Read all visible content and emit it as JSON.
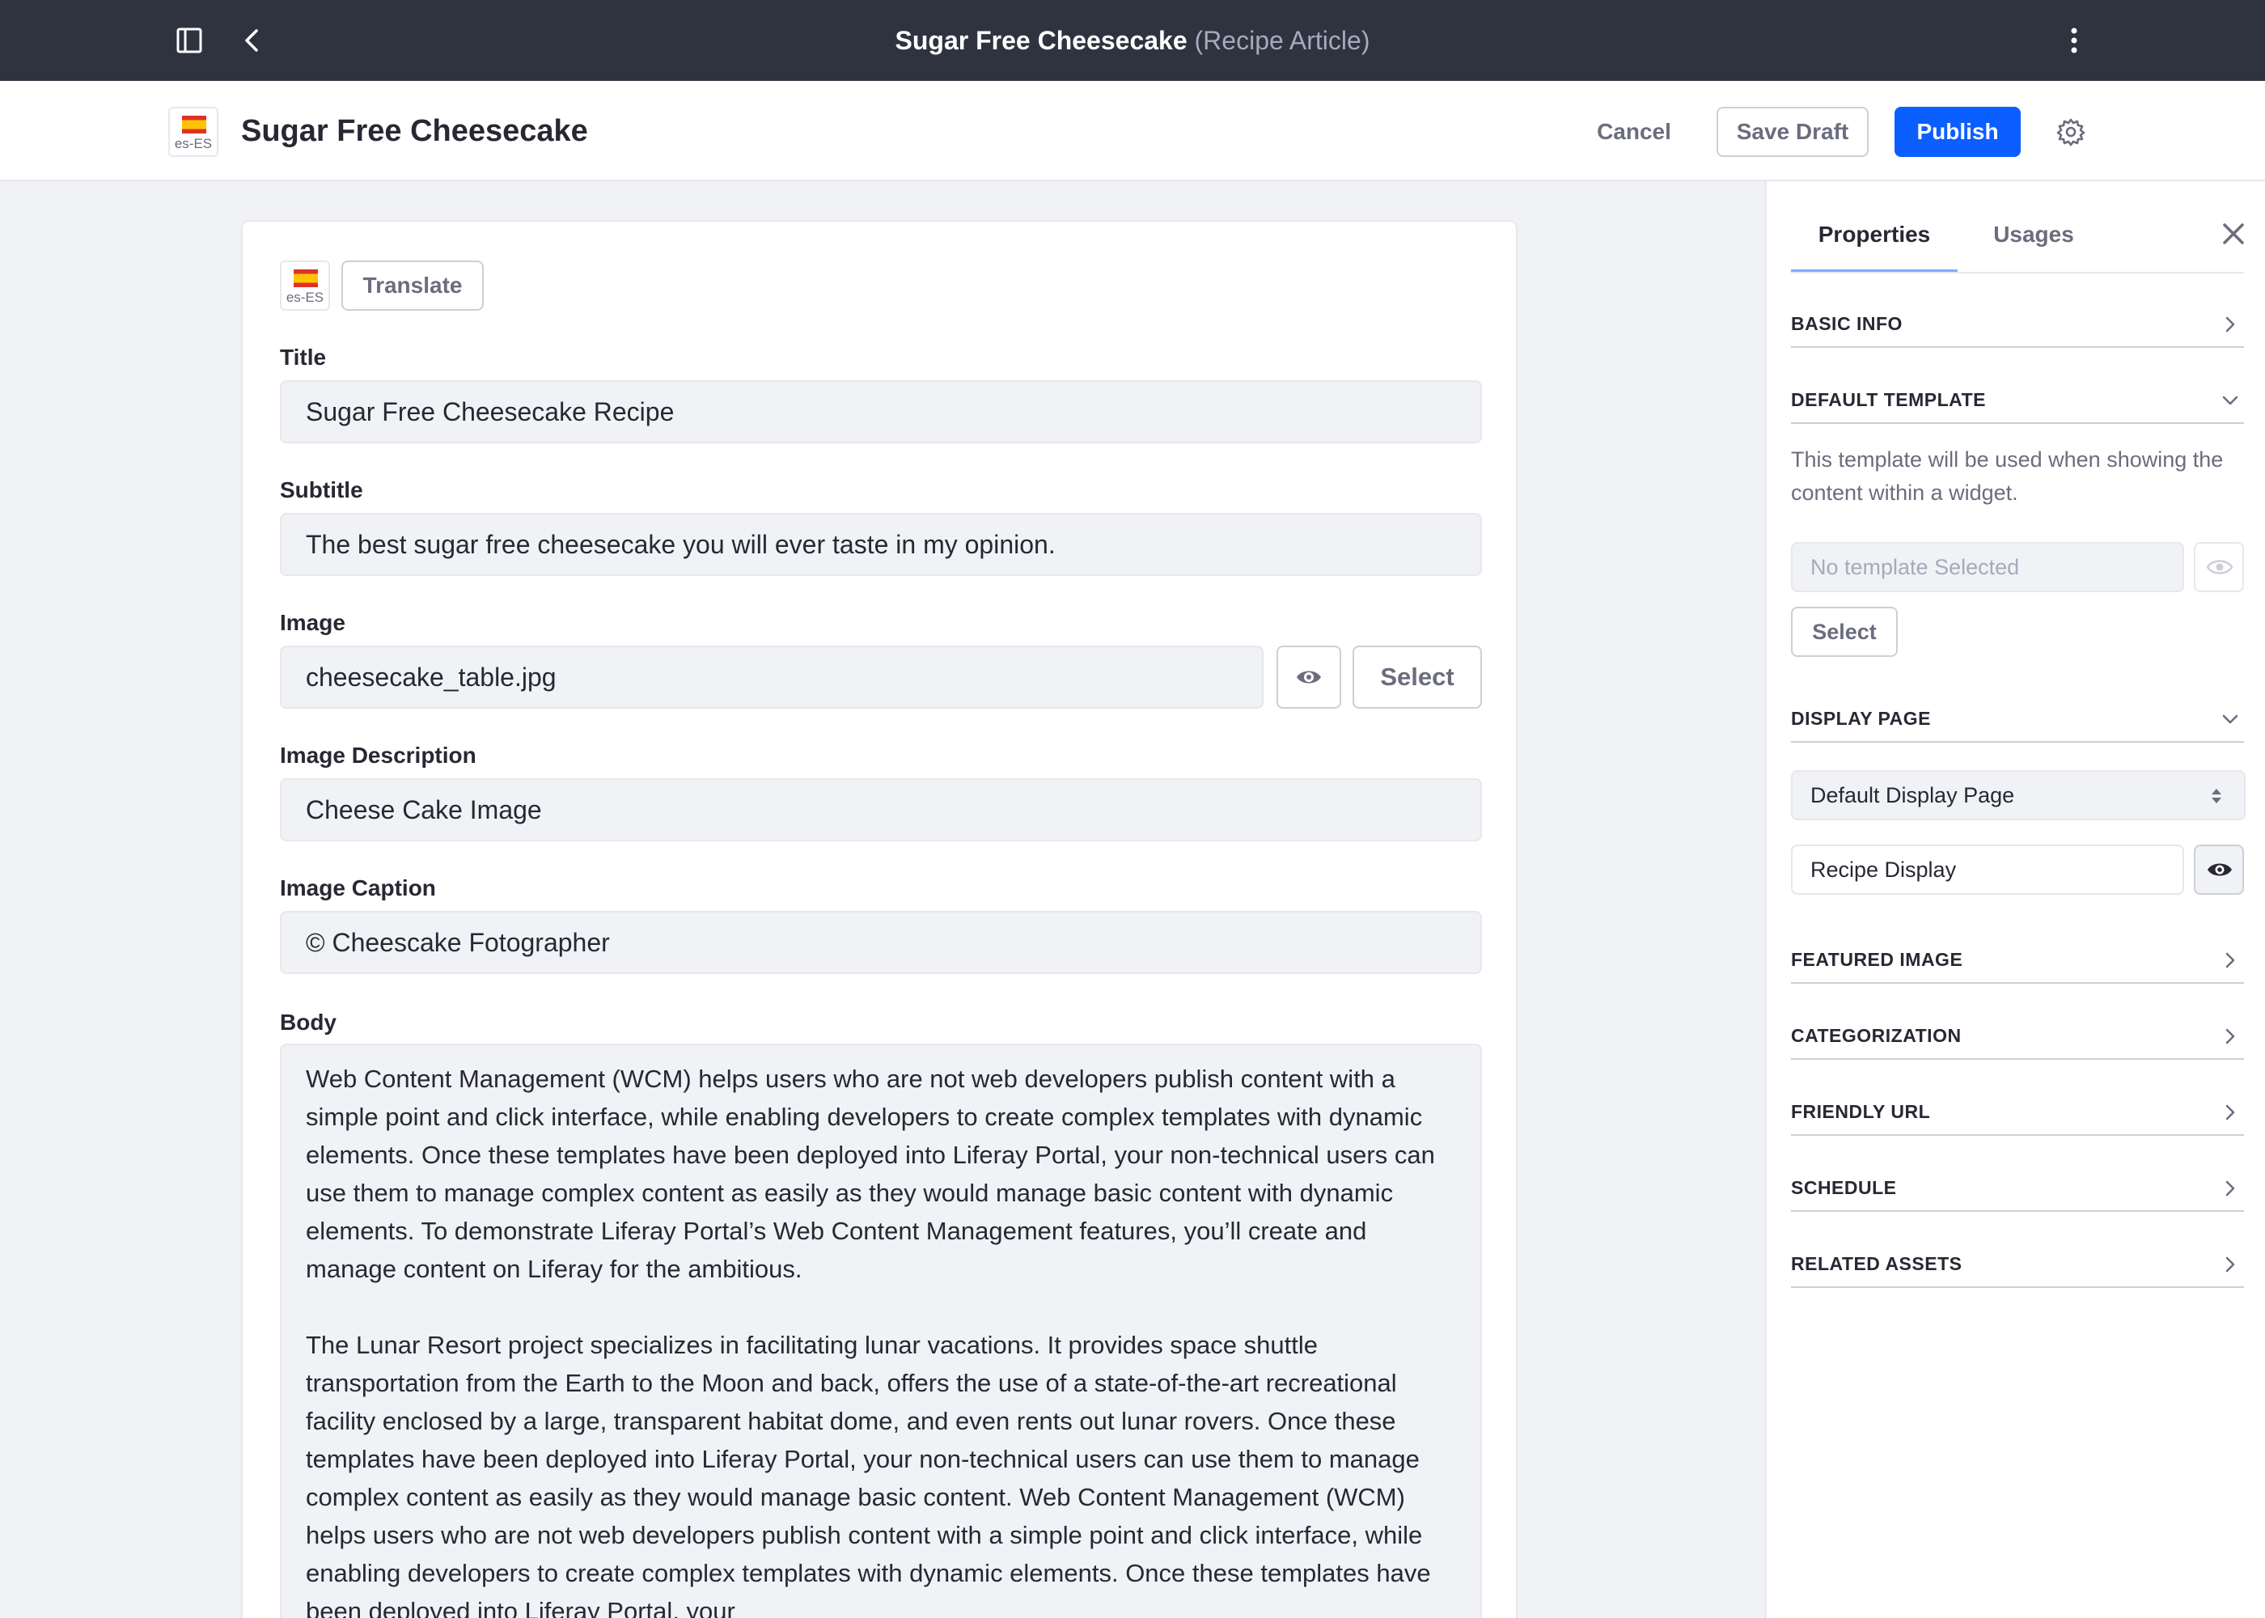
{
  "topbar": {
    "title": "Sugar Free Cheesecake",
    "subtitle": "(Recipe Article)",
    "sidebar_toggle_icon": "panel-toggle-icon",
    "back_icon": "chevron-left-icon",
    "menu_icon": "more-vertical-icon"
  },
  "header": {
    "locale": "es-ES",
    "title": "Sugar Free Cheesecake",
    "cancel_label": "Cancel",
    "save_draft_label": "Save Draft",
    "publish_label": "Publish",
    "settings_icon": "gear-icon"
  },
  "form": {
    "locale": "es-ES",
    "translate_label": "Translate",
    "title_label": "Title",
    "title_value": "Sugar Free Cheesecake Recipe",
    "subtitle_label": "Subtitle",
    "subtitle_value": "The best sugar free cheesecake you will ever taste in my opinion.",
    "image_label": "Image",
    "image_value": "cheesecake_table.jpg",
    "image_select_label": "Select",
    "image_description_label": "Image Description",
    "image_description_value": "Cheese Cake Image",
    "image_caption_label": "Image Caption",
    "image_caption_value": "© Cheescake Fotographer",
    "body_label": "Body",
    "body_paragraphs": [
      "Web Content Management (WCM) helps users who are not web developers publish content with a simple point and click interface, while enabling developers to create complex templates with dynamic elements. Once these templates have been deployed into Liferay Portal, your non-technical users can use them to manage complex content as easily as they would manage basic content with dynamic elements. To demonstrate Liferay Portal’s Web Content Management features, you’ll create and manage content on Liferay for the ambitious.",
      "The Lunar Resort project specializes in facilitating lunar vacations. It provides space shuttle transportation from the Earth to the Moon and back, offers the use of a state-of-the-art recreational facility enclosed by a large, transparent habitat dome, and even rents out lunar rovers. Once these templates have been deployed into Liferay Portal, your non-technical users can use them to manage complex content as easily as they would manage basic content. Web Content Management (WCM) helps users who are not web developers publish content with a simple point and click interface, while enabling developers to create complex templates with dynamic elements. Once these templates have been deployed into Liferay Portal, your"
    ]
  },
  "sidebar": {
    "tabs": [
      {
        "label": "Properties",
        "active": true
      },
      {
        "label": "Usages",
        "active": false
      }
    ],
    "close_icon": "close-icon",
    "sections": {
      "basic_info": "BASIC INFO",
      "default_template": "DEFAULT TEMPLATE",
      "display_page": "DISPLAY PAGE",
      "featured_image": "FEATURED IMAGE",
      "categorization": "CATEGORIZATION",
      "friendly_url": "FRIENDLY URL",
      "schedule": "SCHEDULE",
      "related_assets": "RELATED ASSETS"
    },
    "template_help": "This template will be used when showing the content within a widget.",
    "template_placeholder": "No template Selected",
    "template_select_label": "Select",
    "display_page_select_value": "Default Display Page",
    "display_page_value": "Recipe Display"
  },
  "colors": {
    "topbar_bg": "#2e333f",
    "primary": "#0b5fff",
    "tab_indicator": "#80acff",
    "page_bg": "#f1f2f5"
  }
}
